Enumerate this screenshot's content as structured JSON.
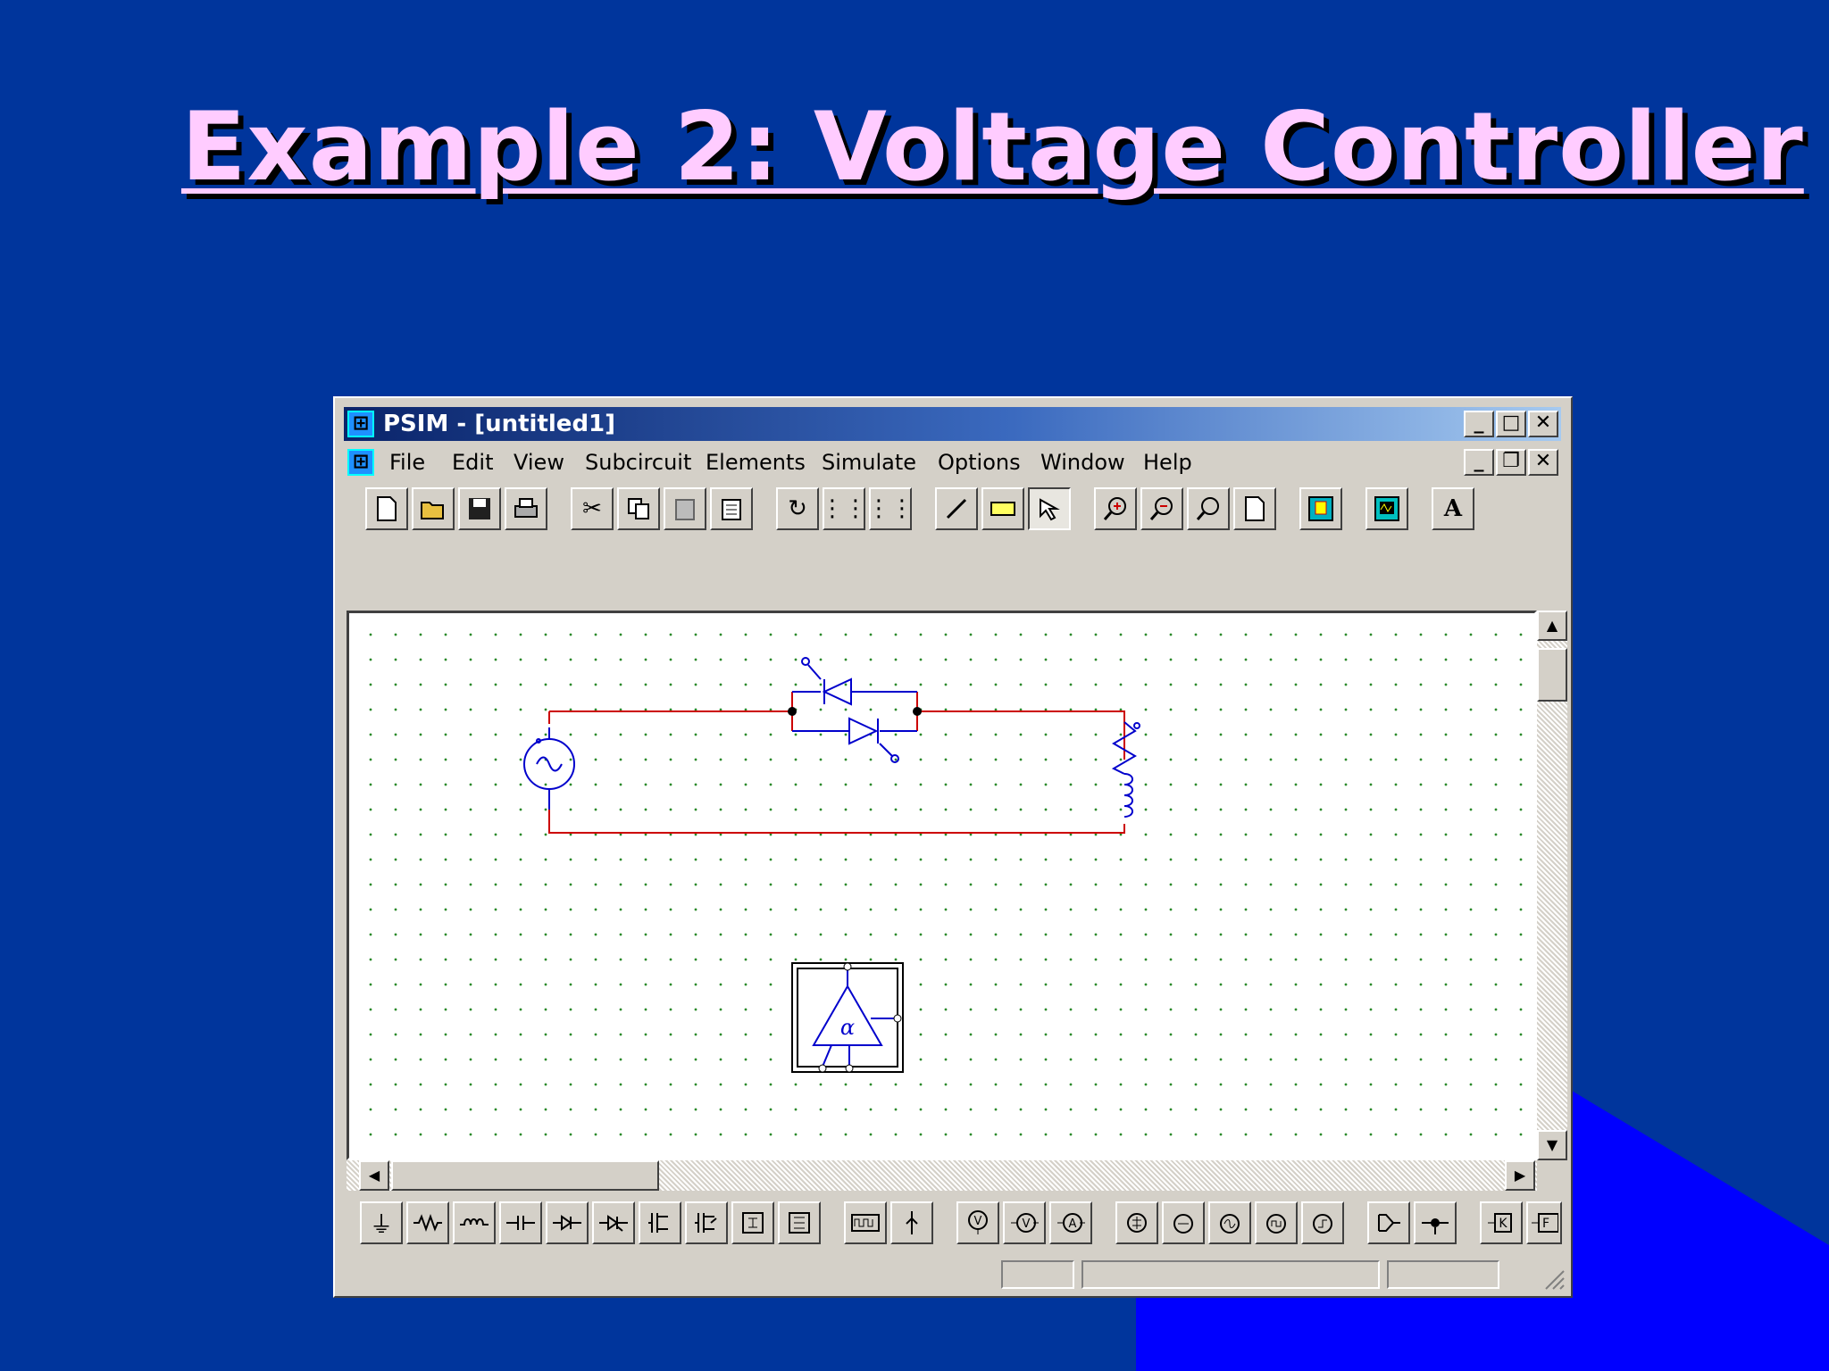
{
  "slide": {
    "title": "Example 2: Voltage Controller"
  },
  "colors": {
    "background": "#00359c",
    "corner_accent": "#0000ff",
    "title_text": "#ffccff",
    "wire": "#cc0000",
    "component": "#0000cc"
  },
  "window": {
    "title": "PSIM - [untitled1]",
    "app_icon": "psim-app-icon",
    "menu": [
      "File",
      "Edit",
      "View",
      "Subcircuit",
      "Elements",
      "Simulate",
      "Options",
      "Window",
      "Help"
    ],
    "toolbar_icons": [
      "new-icon",
      "open-icon",
      "save-icon",
      "print-icon",
      "cut-icon",
      "copy-icon",
      "paste-icon",
      "paste-special-icon",
      "rotate-icon",
      "flip-lr-icon",
      "flip-tb-icon",
      "wire-icon",
      "label-icon",
      "select-icon",
      "zoom-in-icon",
      "zoom-out-icon",
      "zoom-fit-icon",
      "page-icon",
      "run-simulation-icon",
      "simview-icon",
      "text-icon"
    ],
    "text_tool_label": "A",
    "combo_value": "",
    "bottom_toolbar_icons": [
      "ground-icon",
      "resistor-icon",
      "inductor-icon",
      "capacitor-icon",
      "diode-icon",
      "thyristor-icon",
      "igbt-icon",
      "mosfet-icon",
      "switch-module-icon",
      "switch-module2-icon",
      "pulse-source-icon",
      "probe-icon",
      "voltmeter-icon",
      "voltage-probe-icon",
      "ammeter-icon",
      "dc-source-icon",
      "ac-source-icon",
      "current-source-icon",
      "sine-source-icon",
      "step-source-icon",
      "comparator-icon",
      "gating-icon",
      "k-block-icon",
      "f-block-icon"
    ],
    "bottom_labels": {
      "k": "K",
      "f": "F"
    }
  }
}
